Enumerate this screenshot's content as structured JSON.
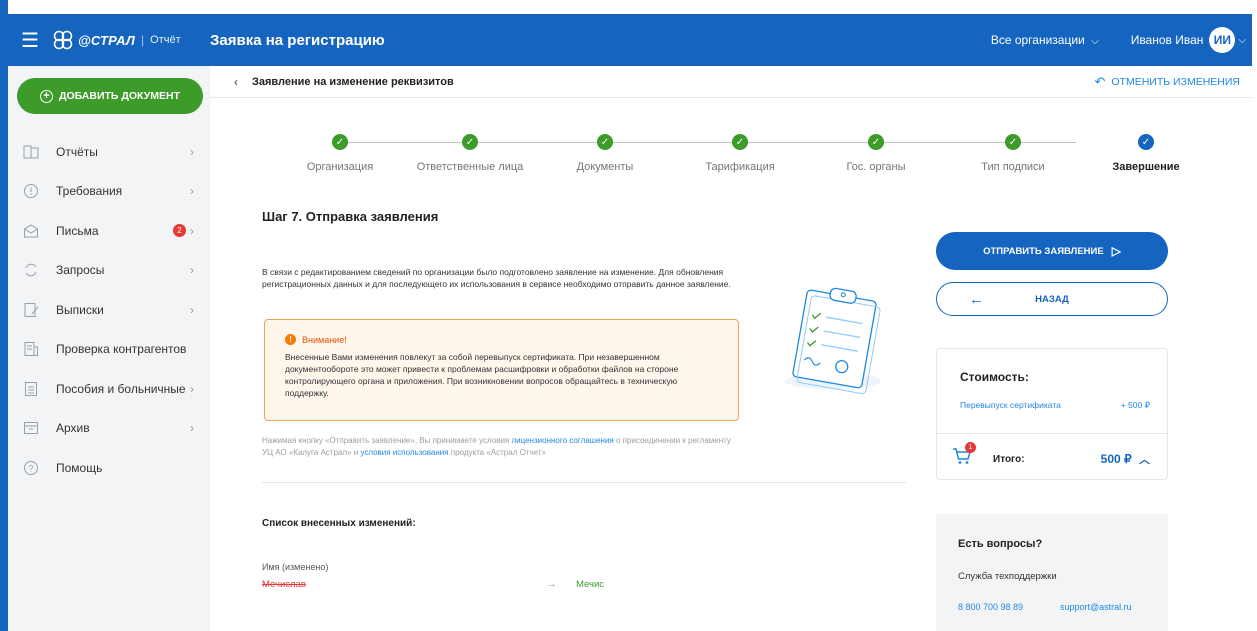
{
  "header": {
    "logo_brand": "@СТРАЛ",
    "logo_product": "Отчёт",
    "title": "Заявка на регистрацию",
    "org_selector": "Все организации",
    "user_name": "Иванов Иван",
    "avatar_initials": "ИИ"
  },
  "sidebar": {
    "add_button": "ДОБАВИТЬ ДОКУМЕНТ",
    "items": [
      {
        "label": "Отчёты",
        "icon": "reports-icon",
        "chevron": true
      },
      {
        "label": "Требования",
        "icon": "requirements-icon",
        "chevron": true
      },
      {
        "label": "Письма",
        "icon": "mail-icon",
        "chevron": true,
        "badge": "2"
      },
      {
        "label": "Запросы",
        "icon": "requests-icon",
        "chevron": true
      },
      {
        "label": "Выписки",
        "icon": "statements-icon",
        "chevron": true
      },
      {
        "label": "Проверка контрагентов",
        "icon": "counterparty-icon",
        "chevron": false
      },
      {
        "label": "Пособия и больничные",
        "icon": "benefits-icon",
        "chevron": true
      },
      {
        "label": "Архив",
        "icon": "archive-icon",
        "chevron": true
      },
      {
        "label": "Помощь",
        "icon": "help-icon",
        "chevron": false
      }
    ]
  },
  "topbar": {
    "title": "Заявление на изменение реквизитов",
    "cancel_label": "ОТМЕНИТЬ ИЗМЕНЕНИЯ"
  },
  "steps": [
    {
      "label": "Организация",
      "done": true
    },
    {
      "label": "Ответственные лица",
      "done": true
    },
    {
      "label": "Документы",
      "done": true
    },
    {
      "label": "Тарификация",
      "done": true
    },
    {
      "label": "Гос. органы",
      "done": true
    },
    {
      "label": "Тип подписи",
      "done": true
    },
    {
      "label": "Завершение",
      "active": true
    }
  ],
  "content": {
    "heading": "Шаг 7. Отправка заявления",
    "description": "В связи с редактированием сведений по организации было подготовлено заявление на изменение. Для обновления регистрационных данных и для последующего их использования в сервисе необходимо отправить данное заявление.",
    "warning_title": "Внимание!",
    "warning_text": "Внесенные Вами изменения повлекут за собой перевыпуск сертификата. При незавершенном документообороте это может привести к проблемам расшифровки и обработки файлов на стороне контролирующего органа и приложения. При возникновении вопросов обращайтесь в техническую поддержку.",
    "license_part1": "Нажимая кнопку «Отправить заявление», Вы принимаете условия ",
    "license_link1": "лицензионного соглашения",
    "license_part2": " о присоединении к регламенту УЦ АО «Калуга Астрал» и ",
    "license_link2": "условия использования",
    "license_part3": " продукта «Астрал Отчет»",
    "changes_title": "Список внесенных изменений:",
    "change_field": "Имя (изменено)",
    "change_old": "Мечислав",
    "change_new": "Мечис"
  },
  "actions": {
    "send_label": "ОТПРАВИТЬ ЗАЯВЛЕНИЕ",
    "back_label": "НАЗАД"
  },
  "cost": {
    "title": "Стоимость:",
    "item_label": "Перевыпуск сертификата",
    "item_price": "+ 500 ₽",
    "cart_count": "1",
    "total_label": "Итого:",
    "total_value": "500 ₽"
  },
  "help": {
    "title": "Есть вопросы?",
    "subtitle": "Служба техподдержки",
    "phone": "8 800 700 98 89",
    "email": "support@astral.ru"
  },
  "colors": {
    "primary": "#1565c0",
    "success": "#3d9b2a",
    "warning": "#f57c00",
    "danger": "#e53935"
  }
}
